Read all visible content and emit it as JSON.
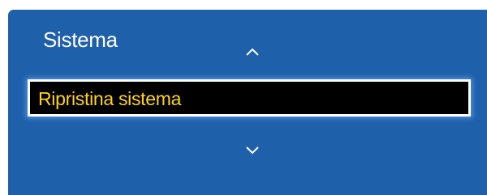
{
  "menu": {
    "title": "Sistema",
    "selected_item": "Ripristina sistema",
    "up_icon": "chevron-up-icon",
    "down_icon": "chevron-down-icon"
  },
  "colors": {
    "panel_bg": "#1f60ab",
    "selected_bg": "#000000",
    "selected_text": "#ffd21f",
    "title_text": "#ffffff"
  }
}
